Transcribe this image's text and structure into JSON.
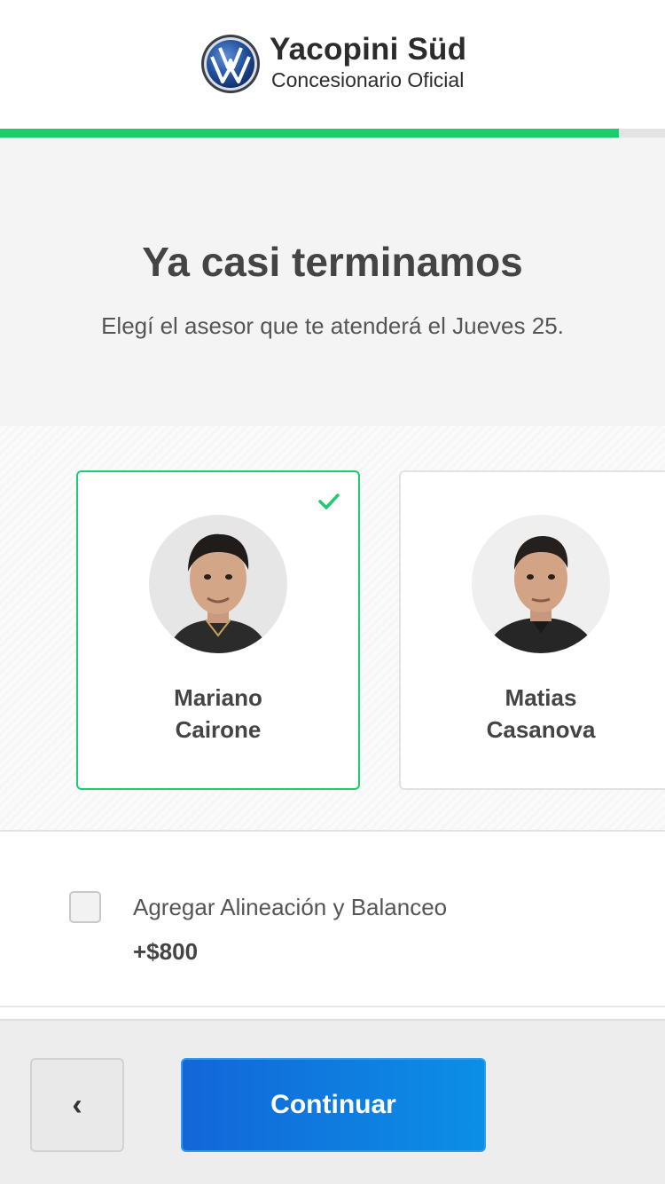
{
  "header": {
    "brand_name": "Yacopini Süd",
    "brand_sub": "Concesionario Oficial",
    "logo_icon": "vw-logo-icon"
  },
  "progress": {
    "value": 0.931
  },
  "intro": {
    "title": "Ya casi terminamos",
    "subtitle": "Elegí el asesor que te atenderá el Jueves 25."
  },
  "advisors": [
    {
      "name": "Mariano\nCairone",
      "selected": true
    },
    {
      "name": "Matias\nCasanova",
      "selected": false
    }
  ],
  "extra": {
    "label": "Agregar Alineación y Balanceo",
    "price": "+$800",
    "checked": false
  },
  "footer": {
    "back_icon": "chevron-left-icon",
    "back_label": "‹",
    "continue_label": "Continuar"
  },
  "colors": {
    "accent_green": "#1ecb6d",
    "button_blue_start": "#1366d8",
    "button_blue_end": "#0b8fe6"
  }
}
